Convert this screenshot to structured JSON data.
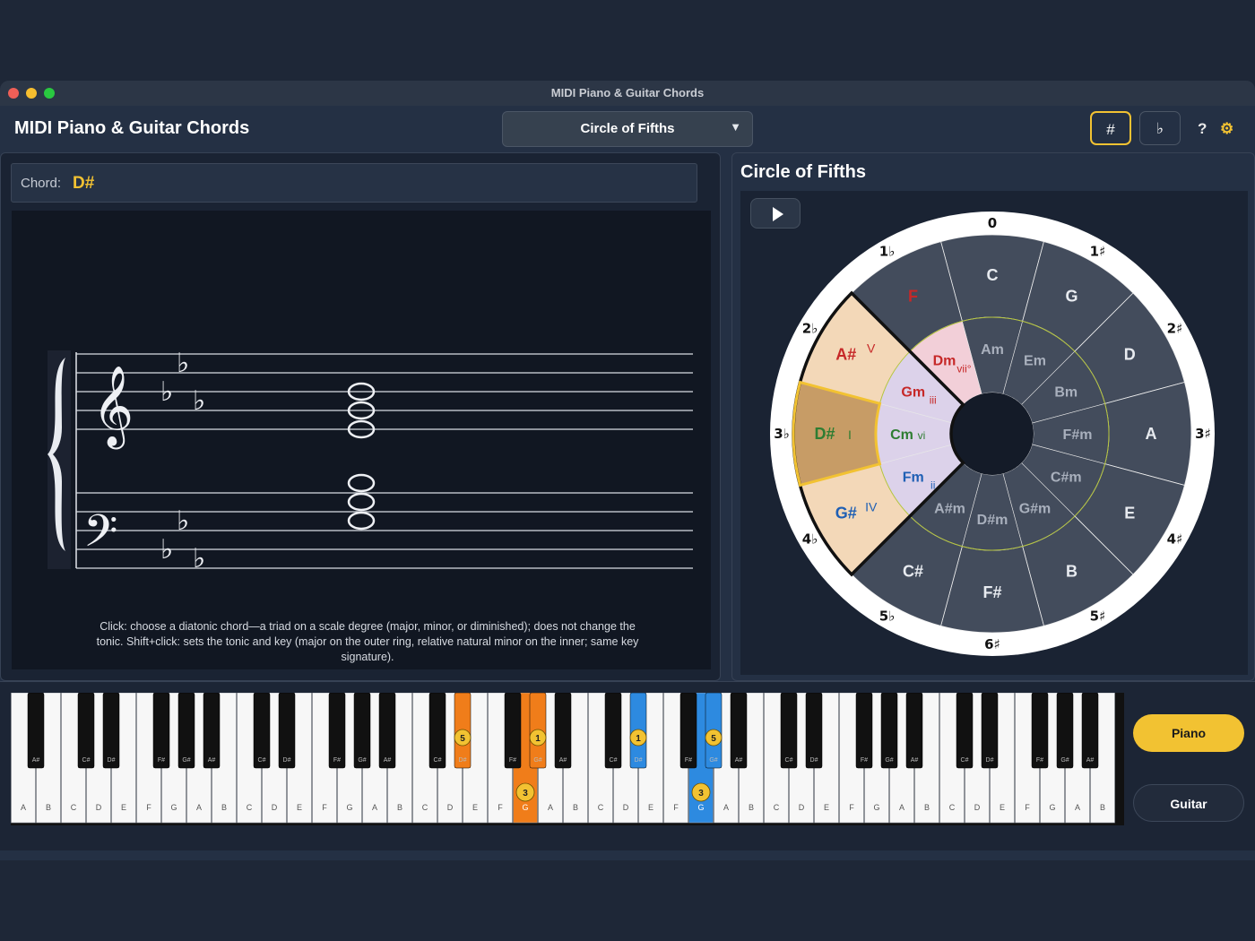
{
  "window": {
    "title": "MIDI Piano & Guitar Chords"
  },
  "header": {
    "app_title": "MIDI Piano & Guitar Chords",
    "view_select": "Circle of Fifths",
    "sharp_label": "#",
    "flat_label": "♭",
    "help_label": "?",
    "settings_label": "⚙"
  },
  "chord": {
    "label": "Chord:",
    "value": "D#"
  },
  "score": {
    "hint": "Click: choose a diatonic chord—a triad on a scale degree (major, minor, or diminished); does not change the tonic. Shift+click: sets the tonic and key (major on the outer ring, relative natural minor on the inner; same key signature).",
    "key_signature_flats": 3
  },
  "circle": {
    "title": "Circle of Fifths",
    "outer_labels": [
      "0",
      "1♯",
      "2♯",
      "3♯",
      "4♯",
      "5♯",
      "6♯",
      "5♭",
      "4♭",
      "3♭",
      "2♭",
      "1♭"
    ],
    "majors": [
      "C",
      "G",
      "D",
      "A",
      "E",
      "B",
      "F#",
      "C#",
      "G#",
      "D#",
      "A#",
      "F"
    ],
    "minors": [
      "Am",
      "Em",
      "Bm",
      "F#m",
      "C#m",
      "G#m",
      "D#m",
      "A#m",
      "Fm",
      "Cm",
      "Gm",
      "Dm"
    ],
    "major_numerals": {
      "G#": "IV",
      "D#": "I",
      "A#": "V"
    },
    "minor_numerals": {
      "Fm": "ii",
      "Cm": "vi",
      "Gm": "iii",
      "Dm": "vii°"
    },
    "selected": "D#",
    "colors": {
      "major_highlight": "#f3d8b8",
      "selected": "#c79c66",
      "minor_highlight": "#dcd2ea",
      "dim_highlight": "#f2cfd8",
      "sector": "#434c5c",
      "ring": "#ffffff",
      "accent": "#f2c232"
    }
  },
  "keyboard": {
    "white_keys": [
      "A",
      "B",
      "C",
      "D",
      "E",
      "F",
      "G",
      "A",
      "B",
      "C",
      "D",
      "E",
      "F",
      "G",
      "A",
      "B",
      "C",
      "D",
      "E",
      "F",
      "G",
      "A",
      "B",
      "C",
      "D",
      "E",
      "F",
      "G",
      "A",
      "B",
      "C",
      "D",
      "E",
      "F",
      "G",
      "A",
      "B",
      "C",
      "D",
      "E",
      "F",
      "G",
      "A",
      "B"
    ],
    "black_keys": [
      "A#",
      "C#",
      "D#",
      "F#",
      "G#",
      "A#",
      "C#",
      "D#",
      "F#",
      "G#",
      "A#",
      "C#",
      "D#",
      "F#",
      "G#",
      "A#",
      "C#",
      "D#",
      "F#",
      "G#",
      "A#",
      "C#",
      "D#",
      "F#",
      "G#",
      "A#",
      "C#",
      "D#",
      "F#",
      "G#",
      "A#"
    ],
    "highlight_white": [
      {
        "index": 20,
        "finger": "3",
        "color": "#f07d1a"
      },
      {
        "index": 27,
        "finger": "3",
        "color": "#2d8ae0"
      }
    ],
    "highlight_black": [
      {
        "index": 12,
        "finger": "5",
        "color": "#f07d1a"
      },
      {
        "index": 14,
        "finger": "1",
        "color": "#f07d1a"
      },
      {
        "index": 17,
        "finger": "1",
        "color": "#2d8ae0"
      },
      {
        "index": 19,
        "finger": "5",
        "color": "#2d8ae0"
      }
    ]
  },
  "instrument": {
    "piano": "Piano",
    "guitar": "Guitar",
    "selected": "Piano"
  }
}
